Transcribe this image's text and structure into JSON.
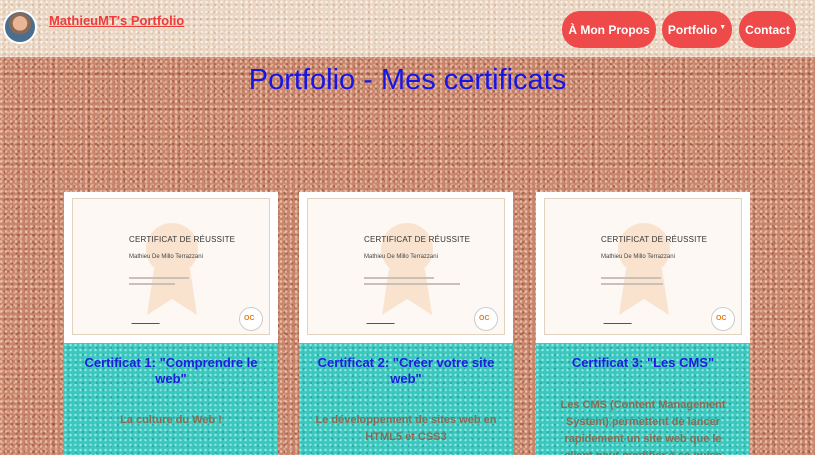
{
  "header": {
    "brand": "MathieuMT's Portfolio",
    "nav": [
      {
        "label": "À Mon Propos"
      },
      {
        "label": "Portfolio",
        "caret": "▼"
      },
      {
        "label": "Contact"
      }
    ]
  },
  "main": {
    "title": "Portfolio - Mes certificats",
    "certificates": [
      {
        "heading": "CERTIFICAT DE RÉUSSITE",
        "name": "Mathieu De Millo Terrazzani",
        "title": "Certificat 1: \"Comprendre le web\"",
        "description": "La culture du Web !"
      },
      {
        "heading": "CERTIFICAT DE RÉUSSITE",
        "name": "Mathieu De Millo Terrazzani",
        "title": "Certificat 2: \"Créer votre site web\"",
        "description": "Le développement de sites web en HTML5 et CSS3"
      },
      {
        "heading": "CERTIFICAT DE RÉUSSITE",
        "name": "Mathieu De Millo Terrazzani",
        "title": "Certificat 3: \"Les CMS\"",
        "description": "Les CMS (Content Management System) permettent de lancer rapidement un site web que le client peut modifier à sa guise"
      }
    ],
    "logo_text": "OC"
  },
  "colors": {
    "nav_bg": "#ee4a4a",
    "brand": "#ee3b3b",
    "title": "#1515e6",
    "card_body": "#3cc7be"
  }
}
